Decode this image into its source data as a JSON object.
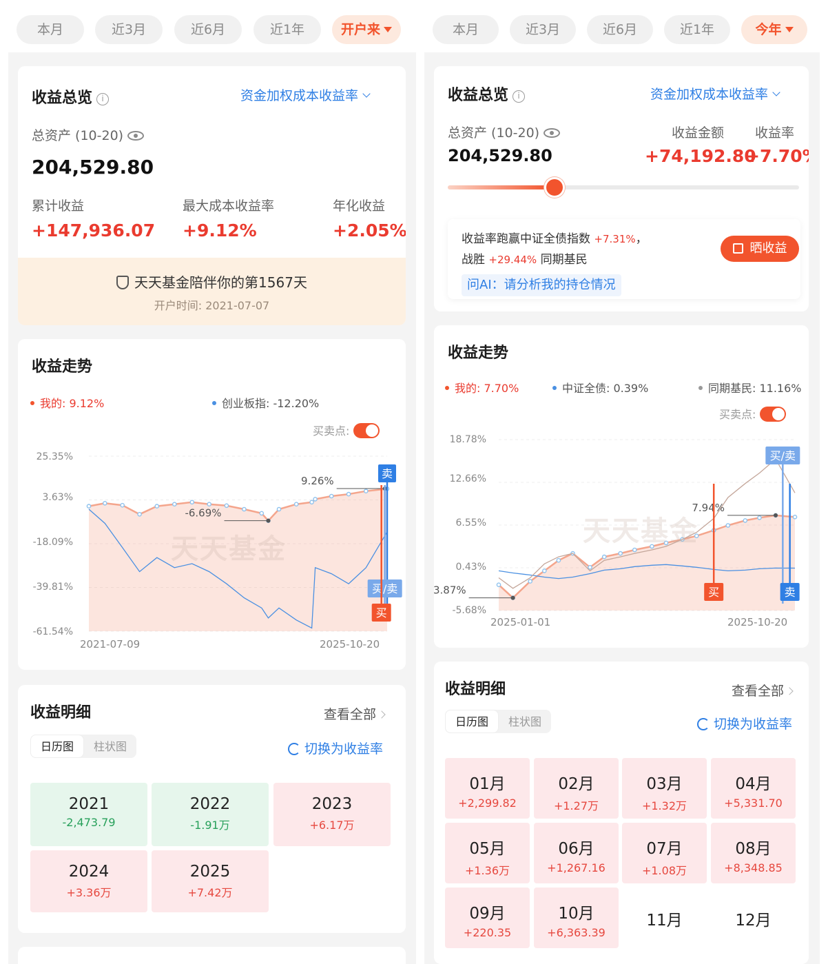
{
  "left": {
    "tabs": [
      {
        "label": "本月",
        "active": false
      },
      {
        "label": "近3月",
        "active": false
      },
      {
        "label": "近6月",
        "active": false
      },
      {
        "label": "近1年",
        "active": false
      },
      {
        "label": "开户来",
        "active": true
      }
    ],
    "overview": {
      "title": "收益总览",
      "rate_mode": "资金加权成本收益率",
      "total_assets_label": "总资产 (10-20)",
      "total_assets_value": "204,529.80",
      "cumulative_label": "累计收益",
      "cumulative_value": "+147,936.07",
      "max_rate_label": "最大成本收益率",
      "max_rate_value": "+9.12%",
      "annual_label": "年化收益",
      "annual_value": "+2.05%",
      "companion_text": "天天基金陪伴你的第1567天",
      "open_date": "开户时间: 2021-07-07"
    },
    "trend": {
      "title": "收益走势",
      "legend_mine": "我的: 9.12%",
      "legend_index": "创业板指: -12.20%",
      "trade_points_label": "买卖点:",
      "watermark": "天天基金",
      "peak_label": "9.26%",
      "low_label": "-6.69%",
      "sell_tag": "卖",
      "buysell_tag": "买/卖",
      "buy_tag": "买"
    },
    "detail": {
      "title": "收益明细",
      "view_all": "查看全部",
      "seg_calendar": "日历图",
      "seg_bar": "柱状图",
      "switch_label": "切换为收益率",
      "years": [
        {
          "year": "2021",
          "value": "-2,473.79",
          "sign": "neg"
        },
        {
          "year": "2022",
          "value": "-1.91万",
          "sign": "neg"
        },
        {
          "year": "2023",
          "value": "+6.17万",
          "sign": "pos"
        },
        {
          "year": "2024",
          "value": "+3.36万",
          "sign": "pos"
        },
        {
          "year": "2025",
          "value": "+7.42万",
          "sign": "pos"
        }
      ]
    }
  },
  "right": {
    "tabs": [
      {
        "label": "本月",
        "active": false
      },
      {
        "label": "近3月",
        "active": false
      },
      {
        "label": "近6月",
        "active": false
      },
      {
        "label": "近1年",
        "active": false
      },
      {
        "label": "今年",
        "active": true
      }
    ],
    "overview": {
      "title": "收益总览",
      "rate_mode": "资金加权成本收益率",
      "total_assets_label": "总资产 (10-20)",
      "total_assets_value": "204,529.80",
      "profit_label": "收益金额",
      "profit_value": "+74,192.80",
      "rate_label": "收益率",
      "rate_value": "+7.70%",
      "beat_line1_prefix": "收益率跑赢中证全债指数",
      "beat_line1_value": "+7.31%",
      "beat_line1_suffix": "，",
      "beat_line2_prefix": "战胜",
      "beat_line2_value": "+29.44%",
      "beat_line2_suffix": "同期基民",
      "share_button": "晒收益",
      "ai_prompt": "问AI：请分析我的持仓情况"
    },
    "trend": {
      "title": "收益走势",
      "legend_mine": "我的: 7.70%",
      "legend_index": "中证全债: 0.39%",
      "legend_peers": "同期基民: 11.16%",
      "trade_points_label": "买卖点:",
      "watermark": "天天基金",
      "peak_label": "7.94%",
      "low_label": "-3.87%",
      "buysell_tag": "买/卖",
      "buy_tag": "买",
      "sell_tag": "卖"
    },
    "detail": {
      "title": "收益明细",
      "view_all": "查看全部",
      "seg_calendar": "日历图",
      "seg_bar": "柱状图",
      "switch_label": "切换为收益率",
      "months": [
        {
          "month": "01月",
          "value": "+2,299.82"
        },
        {
          "month": "02月",
          "value": "+1.27万"
        },
        {
          "month": "03月",
          "value": "+1.32万"
        },
        {
          "month": "04月",
          "value": "+5,331.70"
        },
        {
          "month": "05月",
          "value": "+1.36万"
        },
        {
          "month": "06月",
          "value": "+1,267.16"
        },
        {
          "month": "07月",
          "value": "+1.08万"
        },
        {
          "month": "08月",
          "value": "+8,348.85"
        },
        {
          "month": "09月",
          "value": "+220.35"
        },
        {
          "month": "10月",
          "value": "+6,363.39"
        },
        {
          "month": "11月",
          "value": ""
        },
        {
          "month": "12月",
          "value": ""
        }
      ]
    }
  },
  "chart_data": [
    {
      "type": "line",
      "title": "收益走势",
      "y_tick_labels": [
        "25.35%",
        "3.63%",
        "-18.09%",
        "-39.81%",
        "-61.54%"
      ],
      "ylim": [
        -61.54,
        25.35
      ],
      "x_tick_labels": [
        "2021-07-09",
        "2025-10-20"
      ],
      "x": [
        "2021-07-09",
        "2021-10-01",
        "2022-01-01",
        "2022-04-01",
        "2022-07-01",
        "2022-10-01",
        "2023-01-01",
        "2023-04-01",
        "2023-07-01",
        "2023-10-01",
        "2024-01-01",
        "2024-02-05",
        "2024-04-01",
        "2024-07-01",
        "2024-09-20",
        "2024-10-08",
        "2025-01-01",
        "2025-04-01",
        "2025-07-01",
        "2025-10-20"
      ],
      "series": [
        {
          "name": "我的",
          "color": "#f4a58c",
          "values": [
            0.5,
            2.0,
            1.0,
            -3.5,
            0.5,
            1.5,
            2.5,
            1.5,
            0.8,
            -1.0,
            -3.0,
            -6.69,
            -1.0,
            1.5,
            2.5,
            4.0,
            5.5,
            6.5,
            8.0,
            9.12
          ]
        },
        {
          "name": "创业板指",
          "color": "#4a90e2",
          "values": [
            -1.0,
            -8.0,
            -20.0,
            -32.0,
            -25.0,
            -30.0,
            -28.0,
            -32.0,
            -38.0,
            -45.0,
            -50.0,
            -55.0,
            -50.0,
            -56.0,
            -60.0,
            -30.0,
            -33.0,
            -38.0,
            -30.0,
            -12.2
          ]
        }
      ],
      "annotations": [
        {
          "label": "9.26%",
          "x": "2025-10-08",
          "y": 9.26
        },
        {
          "label": "-6.69%",
          "x": "2024-02-05",
          "y": -6.69
        }
      ],
      "legend": "top"
    },
    {
      "type": "line",
      "title": "收益走势",
      "y_tick_labels": [
        "18.78%",
        "12.66%",
        "6.55%",
        "0.43%",
        "-5.68%"
      ],
      "ylim": [
        -5.68,
        18.78
      ],
      "x_tick_labels": [
        "2025-01-01",
        "2025-10-20"
      ],
      "x": [
        "2025-01-01",
        "2025-01-15",
        "2025-02-01",
        "2025-02-15",
        "2025-03-01",
        "2025-03-15",
        "2025-04-01",
        "2025-04-15",
        "2025-05-01",
        "2025-05-15",
        "2025-06-01",
        "2025-06-15",
        "2025-07-01",
        "2025-07-15",
        "2025-08-01",
        "2025-08-15",
        "2025-09-01",
        "2025-09-15",
        "2025-10-01",
        "2025-10-20"
      ],
      "series": [
        {
          "name": "我的",
          "color": "#f4a58c",
          "values": [
            -2.0,
            -3.87,
            -1.5,
            0.0,
            1.5,
            2.5,
            0.5,
            2.0,
            2.5,
            3.0,
            3.5,
            4.0,
            4.5,
            5.0,
            5.8,
            6.5,
            7.2,
            7.6,
            7.94,
            7.7
          ]
        },
        {
          "name": "中证全债",
          "color": "#4a90e2",
          "values": [
            0.0,
            -0.3,
            -0.6,
            -0.9,
            -1.1,
            -0.9,
            -0.4,
            0.1,
            0.3,
            0.6,
            0.8,
            0.9,
            0.7,
            0.5,
            0.2,
            0.0,
            0.1,
            0.3,
            0.4,
            0.39
          ]
        },
        {
          "name": "同期基民",
          "color": "#c4a69a",
          "values": [
            -1.0,
            -2.5,
            -1.0,
            1.0,
            2.0,
            2.5,
            0.0,
            1.5,
            2.0,
            2.5,
            3.0,
            3.5,
            4.5,
            5.5,
            7.5,
            10.5,
            12.5,
            14.0,
            16.0,
            11.16
          ]
        }
      ],
      "annotations": [
        {
          "label": "7.94%",
          "x": "2025-10-01",
          "y": 7.94
        },
        {
          "label": "-3.87%",
          "x": "2025-01-15",
          "y": -3.87
        }
      ],
      "legend": "top"
    }
  ]
}
